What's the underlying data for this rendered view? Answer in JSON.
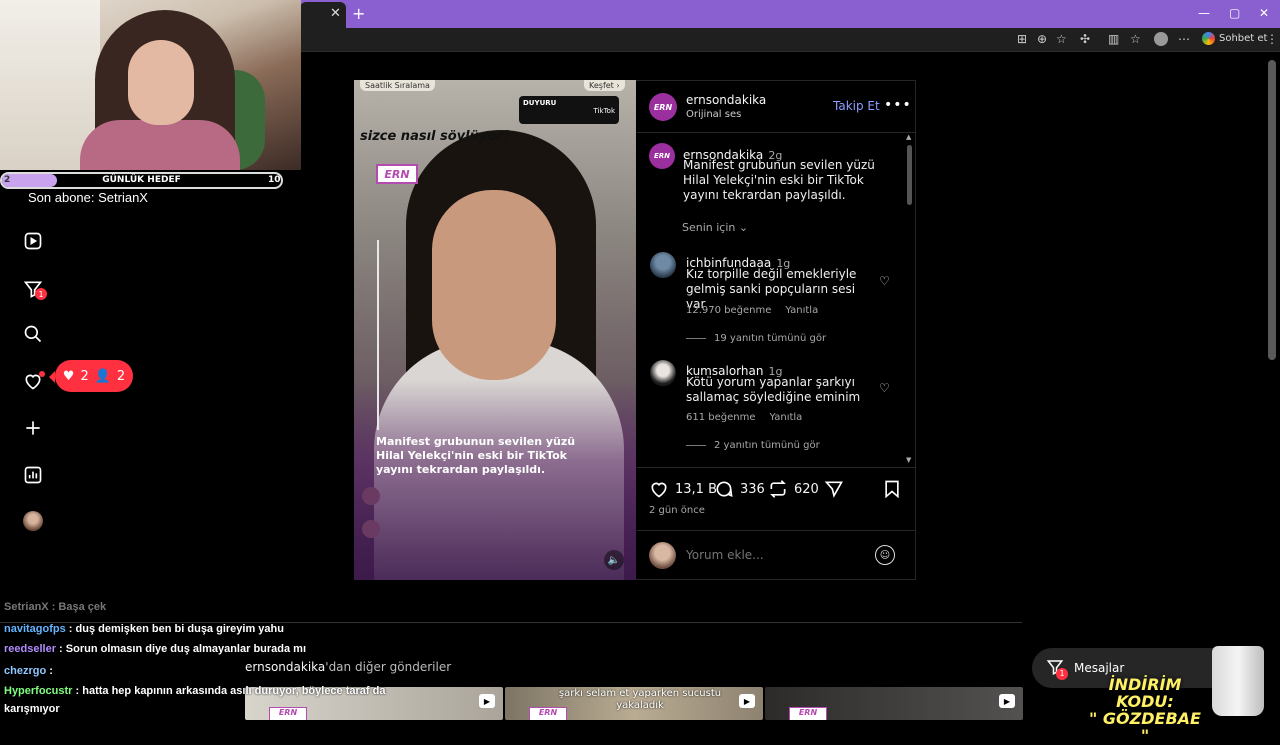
{
  "browser": {
    "tab_close": "✕",
    "new_tab": "+",
    "chat_label": "Sohbet et",
    "window_controls": [
      "—",
      "▢",
      "✕"
    ]
  },
  "stream": {
    "goal": {
      "start": "2",
      "title": "GÜNLÜK HEDEF",
      "end": "10",
      "progress": 0.2
    },
    "last_sub": "Son abone: SetrianX",
    "chat": [
      {
        "user": "SetrianX",
        "text": ": Başa çek",
        "dim": true
      },
      {
        "user": "navitagofps",
        "text": ": duş demişken ben bi duşa gireyim yahu"
      },
      {
        "user": "reedseller",
        "text": ": Sorun olmasın diye duş almayanlar burada mı"
      },
      {
        "user": "chezrgo",
        "text": ":"
      },
      {
        "user": "Hyperfocustr",
        "text": ": hatta hep kapının arkasında asılı duruyor, böylece taraf da"
      },
      {
        "user": "",
        "text": "karışmıyor"
      }
    ],
    "promo_line1": "İNDİRİM KODU:",
    "promo_line2": "\" GÖZDEBAE \""
  },
  "sidebar": {
    "notif_likes": "2",
    "notif_follows": "2",
    "badge": "1"
  },
  "post": {
    "account": "ernsondakika",
    "audio": "Orijinal ses",
    "follow_label": "Takip Et",
    "more": "•••",
    "logo_text": "ERN",
    "video": {
      "top_left": "Saatlik Sıralama",
      "top_right": "Keşfet ›",
      "duyuru_title": "DUYURU",
      "duyuru_brand": "TikTok",
      "question": "sizce nasıl söylüyor?",
      "caption": [
        "Manifest grubunun sevilen yüzü",
        "Hilal Yelekçi'nin eski bir TikTok",
        "yayını tekrardan paylaşıldı."
      ]
    },
    "caption": {
      "user": "ernsondakika",
      "time": "2g",
      "text": "Manifest grubunun sevilen yüzü Hilal Yelekçi'nin eski bir TikTok yayını tekrardan paylaşıldı."
    },
    "for_you": "Senin için",
    "comments": [
      {
        "user": "ichbinfundaaa",
        "time": "1g",
        "text": "Kız torpille değil emekleriyle gelmiş sanki popçuların sesi var",
        "likes": "12.970 beğenme",
        "reply": "Yanıtla",
        "replies": "19 yanıtın tümünü gör"
      },
      {
        "user": "kumsalorhan",
        "time": "1g",
        "text": "Kötü yorum yapanlar şarkıyı sallamaç söylediğine eminim",
        "likes": "611 beğenme",
        "reply": "Yanıtla",
        "replies": "2 yanıtın tümünü gör"
      }
    ],
    "actions": {
      "likes": "13,1 B",
      "comments": "336",
      "reposts": "620"
    },
    "posted": "2 gün önce",
    "comment_placeholder": "Yorum ekle..."
  },
  "more_from": {
    "user": "ernsondakika",
    "suffix": "'dan diğer gönderiler",
    "thumb_caption": "şarkı selam et yaparken sucustu yakaladık"
  },
  "messages": {
    "label": "Mesajlar",
    "badge": "1"
  },
  "colors": {
    "accent": "#8e9dff",
    "notif": "#ff3040",
    "brand": "#9b2f9e",
    "tabbar": "#8a5fd0"
  }
}
